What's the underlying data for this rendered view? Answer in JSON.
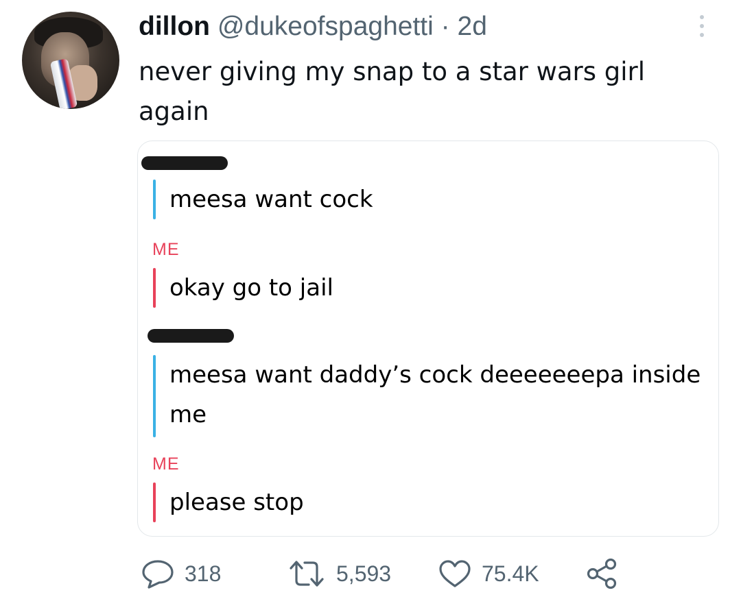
{
  "tweet": {
    "author_name": "dillon",
    "author_handle": "@dukeofspaghetti",
    "separator": "·",
    "timestamp": "2d",
    "text": "never giving my snap to a star wars girl again"
  },
  "chat": {
    "messages": [
      {
        "sender": "redacted",
        "text": "meesa want cock"
      },
      {
        "sender": "ME",
        "text": "okay go to jail"
      },
      {
        "sender": "redacted",
        "text": "meesa want daddy’s cock deeeeeeepa inside me"
      },
      {
        "sender": "ME",
        "text": "please stop"
      }
    ]
  },
  "stats": {
    "replies": "318",
    "retweets": "5,593",
    "likes": "75.4K"
  },
  "icons": {
    "more": "more-vertical-icon",
    "reply": "reply-icon",
    "retweet": "retweet-icon",
    "like": "heart-icon",
    "share": "share-icon"
  },
  "colors": {
    "me_label": "#e8425a",
    "friend_bar": "#3ab1e5",
    "me_bar": "#e8425a",
    "muted_text": "#536471"
  }
}
